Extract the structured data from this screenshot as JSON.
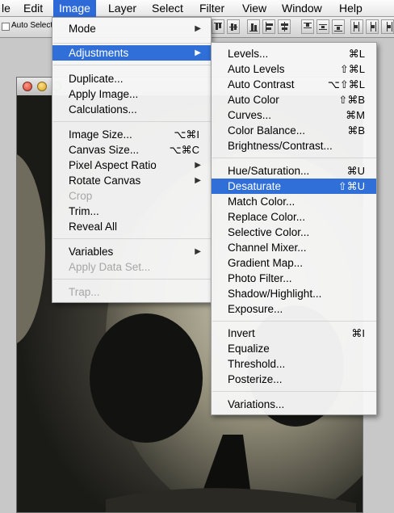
{
  "menubar": {
    "items": [
      "le",
      "Edit",
      "Image",
      "Layer",
      "Select",
      "Filter",
      "View",
      "Window",
      "Help"
    ]
  },
  "toolbar": {
    "auto_select_label": "Auto Select"
  },
  "image_menu": {
    "items": [
      {
        "label": "Mode",
        "submenu": true
      },
      {
        "label": "Adjustments",
        "submenu": true,
        "highlighted": true
      },
      {
        "label": "Duplicate..."
      },
      {
        "label": "Apply Image..."
      },
      {
        "label": "Calculations..."
      },
      {
        "label": "Image Size...",
        "shortcut": "⌥⌘I"
      },
      {
        "label": "Canvas Size...",
        "shortcut": "⌥⌘C"
      },
      {
        "label": "Pixel Aspect Ratio",
        "submenu": true
      },
      {
        "label": "Rotate Canvas",
        "submenu": true
      },
      {
        "label": "Crop",
        "disabled": true
      },
      {
        "label": "Trim..."
      },
      {
        "label": "Reveal All"
      },
      {
        "label": "Variables",
        "submenu": true
      },
      {
        "label": "Apply Data Set...",
        "disabled": true
      },
      {
        "label": "Trap...",
        "disabled": true
      }
    ]
  },
  "adjustments_menu": {
    "items": [
      {
        "label": "Levels...",
        "shortcut": "⌘L"
      },
      {
        "label": "Auto Levels",
        "shortcut": "⇧⌘L"
      },
      {
        "label": "Auto Contrast",
        "shortcut": "⌥⇧⌘L"
      },
      {
        "label": "Auto Color",
        "shortcut": "⇧⌘B"
      },
      {
        "label": "Curves...",
        "shortcut": "⌘M"
      },
      {
        "label": "Color Balance...",
        "shortcut": "⌘B"
      },
      {
        "label": "Brightness/Contrast..."
      },
      {
        "label": "Hue/Saturation...",
        "shortcut": "⌘U"
      },
      {
        "label": "Desaturate",
        "shortcut": "⇧⌘U",
        "highlighted": true
      },
      {
        "label": "Match Color..."
      },
      {
        "label": "Replace Color..."
      },
      {
        "label": "Selective Color..."
      },
      {
        "label": "Channel Mixer..."
      },
      {
        "label": "Gradient Map..."
      },
      {
        "label": "Photo Filter..."
      },
      {
        "label": "Shadow/Highlight..."
      },
      {
        "label": "Exposure..."
      },
      {
        "label": "Invert",
        "shortcut": "⌘I"
      },
      {
        "label": "Equalize"
      },
      {
        "label": "Threshold..."
      },
      {
        "label": "Posterize..."
      },
      {
        "label": "Variations..."
      }
    ]
  },
  "colors": {
    "highlight": "#2f6fd7",
    "disabled_text": "#a6a6a6"
  }
}
